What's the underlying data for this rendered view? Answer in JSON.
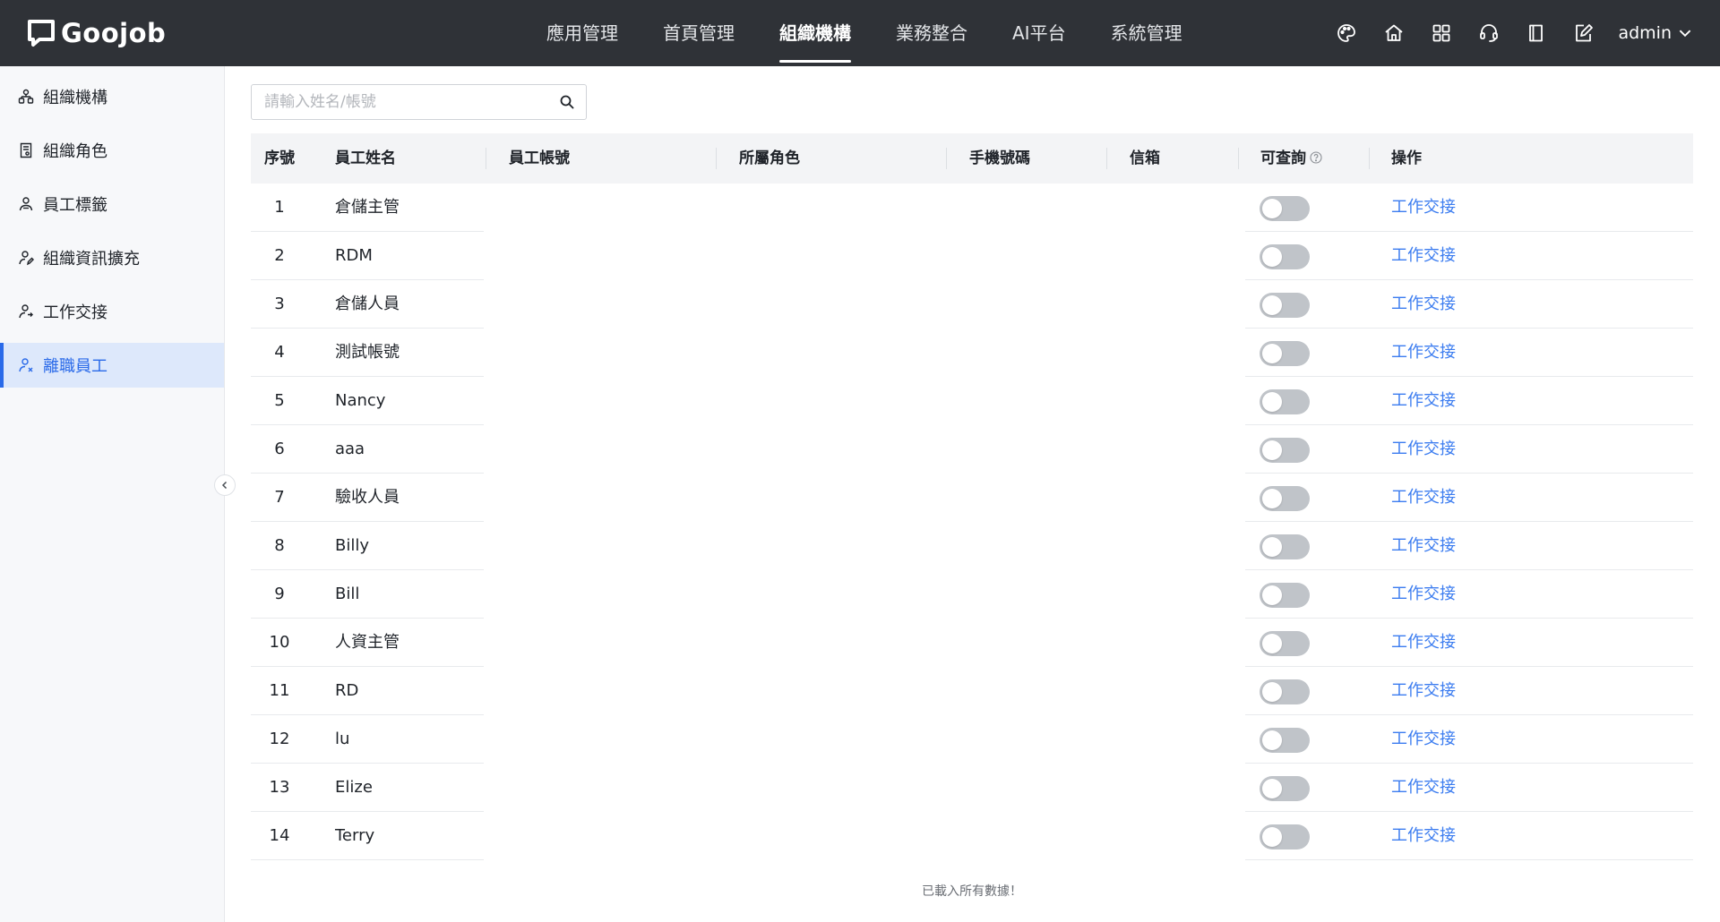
{
  "brand": {
    "name": "Goojob"
  },
  "nav": {
    "items": [
      {
        "label": "應用管理",
        "active": false
      },
      {
        "label": "首頁管理",
        "active": false
      },
      {
        "label": "組織機構",
        "active": true
      },
      {
        "label": "業務整合",
        "active": false
      },
      {
        "label": "AI平台",
        "active": false
      },
      {
        "label": "系統管理",
        "active": false
      }
    ]
  },
  "header_tools": {
    "icons": [
      "palette-icon",
      "home-icon",
      "apps-grid-icon",
      "support-icon",
      "book-icon",
      "edit-export-icon"
    ],
    "user": "admin"
  },
  "sidebar": {
    "items": [
      {
        "label": "組織機構",
        "icon": "org-tree-icon",
        "active": false
      },
      {
        "label": "組織角色",
        "icon": "role-doc-icon",
        "active": false
      },
      {
        "label": "員工標籤",
        "icon": "people-tag-icon",
        "active": false
      },
      {
        "label": "組織資訊擴充",
        "icon": "user-edit-icon",
        "active": false
      },
      {
        "label": "工作交接",
        "icon": "user-swap-icon",
        "active": false
      },
      {
        "label": "離職員工",
        "icon": "user-leave-icon",
        "active": true
      }
    ]
  },
  "search": {
    "placeholder": "請輸入姓名/帳號"
  },
  "table": {
    "headers": {
      "index": "序號",
      "name": "員工姓名",
      "account": "員工帳號",
      "role": "所屬角色",
      "phone": "手機號碼",
      "email": "信箱",
      "queryable": "可查詢",
      "action": "操作"
    },
    "rows": [
      {
        "index": "1",
        "name": "倉儲主管",
        "queryable": false,
        "action": "工作交接"
      },
      {
        "index": "2",
        "name": "RDM",
        "queryable": false,
        "action": "工作交接"
      },
      {
        "index": "3",
        "name": "倉儲人員",
        "queryable": false,
        "action": "工作交接"
      },
      {
        "index": "4",
        "name": "測試帳號",
        "queryable": false,
        "action": "工作交接"
      },
      {
        "index": "5",
        "name": "Nancy",
        "queryable": false,
        "action": "工作交接"
      },
      {
        "index": "6",
        "name": "aaa",
        "queryable": false,
        "action": "工作交接"
      },
      {
        "index": "7",
        "name": "驗收人員",
        "queryable": false,
        "action": "工作交接"
      },
      {
        "index": "8",
        "name": "Billy",
        "queryable": false,
        "action": "工作交接"
      },
      {
        "index": "9",
        "name": "Bill",
        "queryable": false,
        "action": "工作交接"
      },
      {
        "index": "10",
        "name": "人資主管",
        "queryable": false,
        "action": "工作交接"
      },
      {
        "index": "11",
        "name": "RD",
        "queryable": false,
        "action": "工作交接"
      },
      {
        "index": "12",
        "name": "lu",
        "queryable": false,
        "action": "工作交接"
      },
      {
        "index": "13",
        "name": "Elize",
        "queryable": false,
        "action": "工作交接"
      },
      {
        "index": "14",
        "name": "Terry",
        "queryable": false,
        "action": "工作交接"
      }
    ]
  },
  "footer": {
    "loaded_message": "已載入所有數據！"
  },
  "colors": {
    "topbar": "#2f3237",
    "accent": "#2a6ae9",
    "link": "#3b7cf0",
    "sidebar_bg": "#f7f8fa",
    "header_bg": "#f3f4f6"
  }
}
